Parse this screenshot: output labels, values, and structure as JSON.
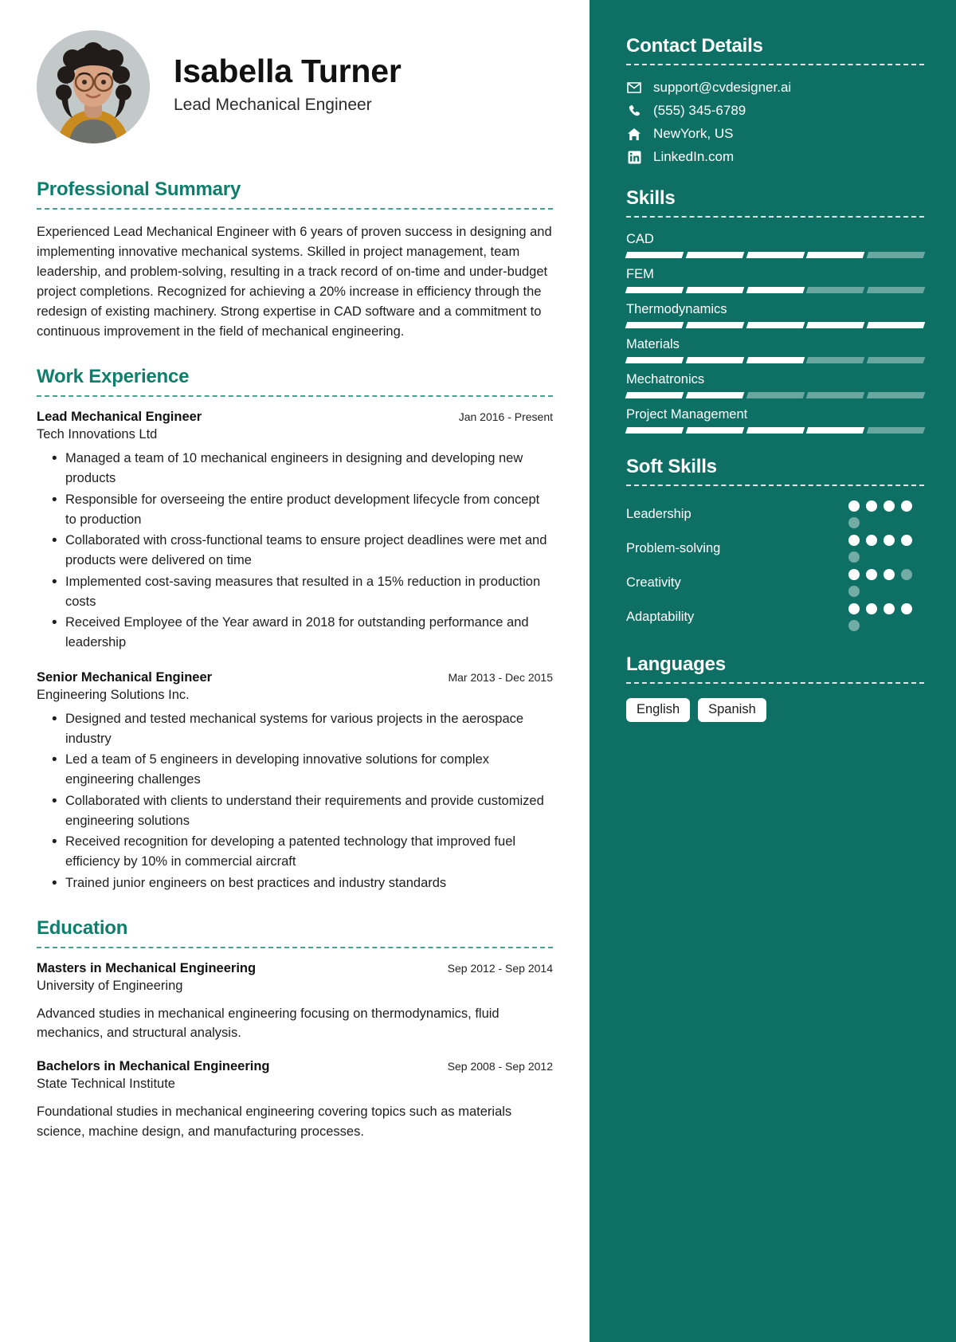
{
  "header": {
    "name": "Isabella Turner",
    "role": "Lead Mechanical Engineer",
    "avatar_icon": "profile-photo"
  },
  "theme": {
    "accent": "#107e6c",
    "sidebar_bg": "#0e7065",
    "text": "#1e1e1e",
    "pill_bg": "#ffffff"
  },
  "summary": {
    "title": "Professional Summary",
    "text": "Experienced Lead Mechanical Engineer with 6 years of proven success in designing and implementing innovative mechanical systems. Skilled in project management, team leadership, and problem-solving, resulting in a track record of on-time and under-budget project completions. Recognized for achieving a 20% increase in efficiency through the redesign of existing machinery. Strong expertise in CAD software and a commitment to continuous improvement in the field of mechanical engineering."
  },
  "work": {
    "title": "Work Experience",
    "jobs": [
      {
        "title": "Lead Mechanical Engineer",
        "dates": "Jan 2016 - Present",
        "org": "Tech Innovations Ltd",
        "bullets": [
          "Managed a team of 10 mechanical engineers in designing and developing new products",
          "Responsible for overseeing the entire product development lifecycle from concept to production",
          "Collaborated with cross-functional teams to ensure project deadlines were met and products were delivered on time",
          "Implemented cost-saving measures that resulted in a 15% reduction in production costs",
          "Received Employee of the Year award in 2018 for outstanding performance and leadership"
        ]
      },
      {
        "title": "Senior Mechanical Engineer",
        "dates": "Mar 2013 - Dec 2015",
        "org": "Engineering Solutions Inc.",
        "bullets": [
          "Designed and tested mechanical systems for various projects in the aerospace industry",
          "Led a team of 5 engineers in developing innovative solutions for complex engineering challenges",
          "Collaborated with clients to understand their requirements and provide customized engineering solutions",
          "Received recognition for developing a patented technology that improved fuel efficiency by 10% in commercial aircraft",
          "Trained junior engineers on best practices and industry standards"
        ]
      }
    ]
  },
  "education": {
    "title": "Education",
    "entries": [
      {
        "degree": "Masters in Mechanical Engineering",
        "dates": "Sep 2012 - Sep 2014",
        "school": "University of Engineering",
        "description": "Advanced studies in mechanical engineering focusing on thermodynamics, fluid mechanics, and structural analysis."
      },
      {
        "degree": "Bachelors in Mechanical Engineering",
        "dates": "Sep 2008 - Sep 2012",
        "school": "State Technical Institute",
        "description": "Foundational studies in mechanical engineering covering topics such as materials science, machine design, and manufacturing processes."
      }
    ]
  },
  "sidebar": {
    "contact": {
      "title": "Contact Details",
      "items": [
        {
          "icon": "envelope-icon",
          "value": "support@cvdesigner.ai"
        },
        {
          "icon": "phone-icon",
          "value": "(555) 345-6789"
        },
        {
          "icon": "home-icon",
          "value": "NewYork, US"
        },
        {
          "icon": "linkedin-icon",
          "value": "LinkedIn.com"
        }
      ]
    },
    "skills": {
      "title": "Skills",
      "max": 5,
      "items": [
        {
          "name": "CAD",
          "level": 4
        },
        {
          "name": "FEM",
          "level": 3
        },
        {
          "name": "Thermodynamics",
          "level": 5
        },
        {
          "name": "Materials",
          "level": 3
        },
        {
          "name": "Mechatronics",
          "level": 2
        },
        {
          "name": "Project Management",
          "level": 4
        }
      ]
    },
    "soft_skills": {
      "title": "Soft Skills",
      "max": 5,
      "items": [
        {
          "name": "Leadership",
          "level": 4
        },
        {
          "name": "Problem-solving",
          "level": 4
        },
        {
          "name": "Creativity",
          "level": 3
        },
        {
          "name": "Adaptability",
          "level": 4
        }
      ]
    },
    "languages": {
      "title": "Languages",
      "items": [
        "English",
        "Spanish"
      ]
    }
  }
}
